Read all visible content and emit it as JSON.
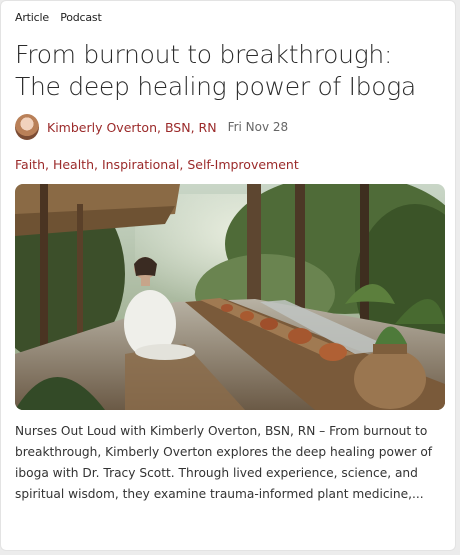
{
  "tags": [
    "Article",
    "Podcast"
  ],
  "title": "From burnout to breakthrough: The deep healing power of Iboga",
  "author": {
    "name": "Kimberly Overton, BSN, RN",
    "date": "Fri Nov 28"
  },
  "categories": [
    "Faith",
    "Health",
    "Inspirational",
    "Self-Improvement"
  ],
  "excerpt": "Nurses Out Loud with Kimberly Overton, BSN, RN – From burnout to breakthrough, Kimberly Overton explores the deep healing power of iboga with Dr. Tracy Scott. Through lived experience, science, and spiritual wisdom, they examine trauma-informed plant medicine,...",
  "colors": {
    "link": "#9b2a2a",
    "text": "#2b2b2b"
  }
}
